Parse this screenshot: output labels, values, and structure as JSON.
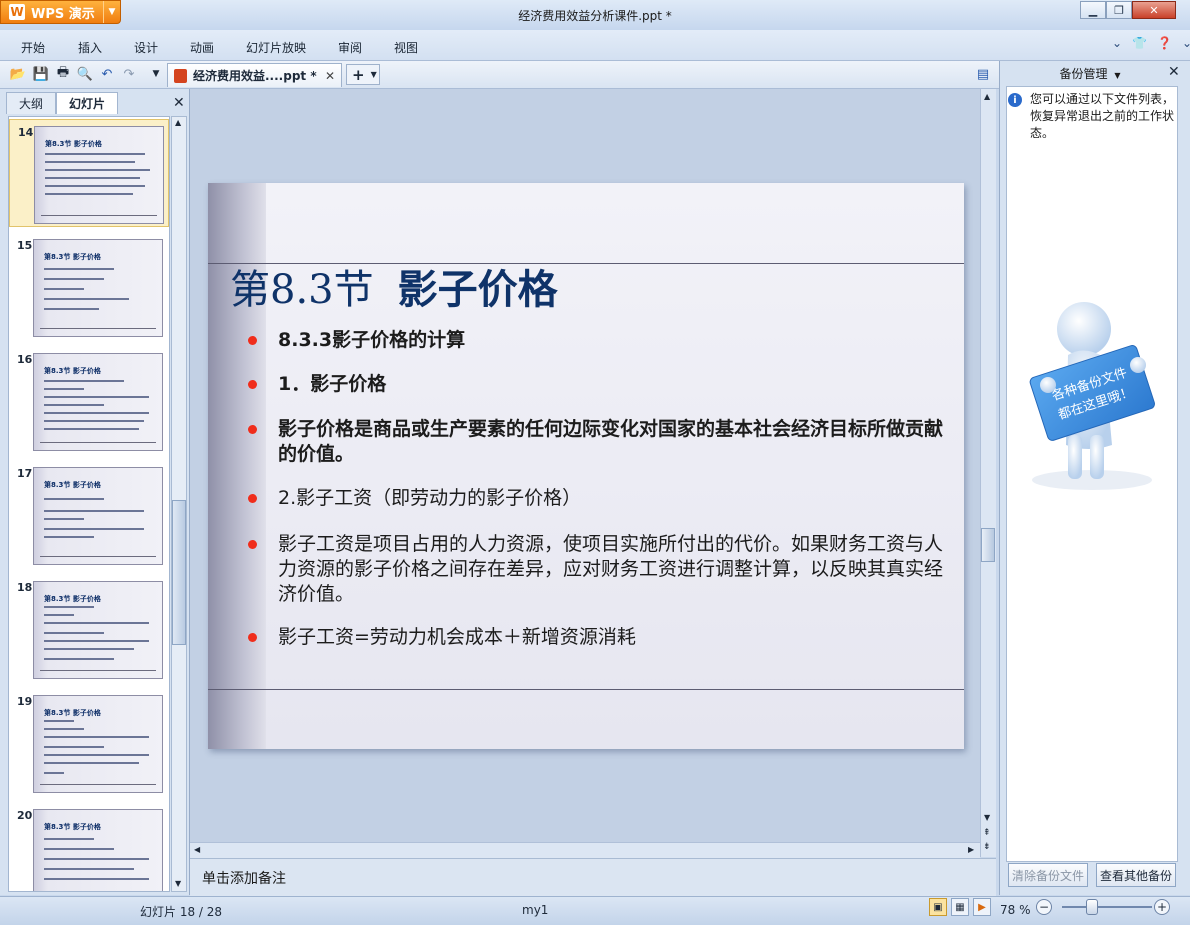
{
  "app": {
    "badge": "WPS 演示",
    "window_title": "经济费用效益分析课件.ppt *"
  },
  "menu": [
    "开始",
    "插入",
    "设计",
    "动画",
    "幻灯片放映",
    "审阅",
    "视图"
  ],
  "document_tab": {
    "label": "经济费用效益....ppt *"
  },
  "left_panel": {
    "tabs": [
      "大纲",
      "幻灯片"
    ],
    "thumbnails": [
      {
        "num": "14",
        "title": "第8.3节 影子价格"
      },
      {
        "num": "15",
        "title": "第8.3节 影子价格"
      },
      {
        "num": "16",
        "title": "第8.3节 影子价格"
      },
      {
        "num": "17",
        "title": "第8.3节 影子价格"
      },
      {
        "num": "18",
        "title": "第8.3节 影子价格"
      },
      {
        "num": "19",
        "title": "第8.3节 影子价格"
      },
      {
        "num": "20",
        "title": "第8.3节 影子价格"
      }
    ]
  },
  "slide": {
    "title_part1": "第8.3节",
    "title_part2": "影子价格",
    "bullets": [
      {
        "text": "8.3.3影子价格的计算",
        "bold": true
      },
      {
        "text": "1．影子价格",
        "bold": true
      },
      {
        "text": "影子价格是商品或生产要素的任何边际变化对国家的基本社会经济目标所做贡献的价值。",
        "bold": true
      },
      {
        "text": "2.影子工资（即劳动力的影子价格）",
        "bold": false
      },
      {
        "text": "影子工资是项目占用的人力资源，使项目实施所付出的代价。如果财务工资与人力资源的影子价格之间存在差异，应对财务工资进行调整计算，以反映其真实经济价值。",
        "bold": false
      },
      {
        "text": "影子工资=劳动力机会成本＋新增资源消耗",
        "bold": false
      }
    ]
  },
  "notes": {
    "placeholder": "单击添加备注"
  },
  "right_panel": {
    "title": "备份管理",
    "info": "您可以通过以下文件列表，恢复异常退出之前的工作状态。",
    "sign_text_line1": "各种备份文件",
    "sign_text_line2": "都在这里哦！",
    "clear_button": "清除备份文件",
    "view_button": "查看其他备份"
  },
  "status": {
    "slide_indicator": "幻灯片 18 / 28",
    "theme": "my1",
    "zoom": "78 %"
  }
}
